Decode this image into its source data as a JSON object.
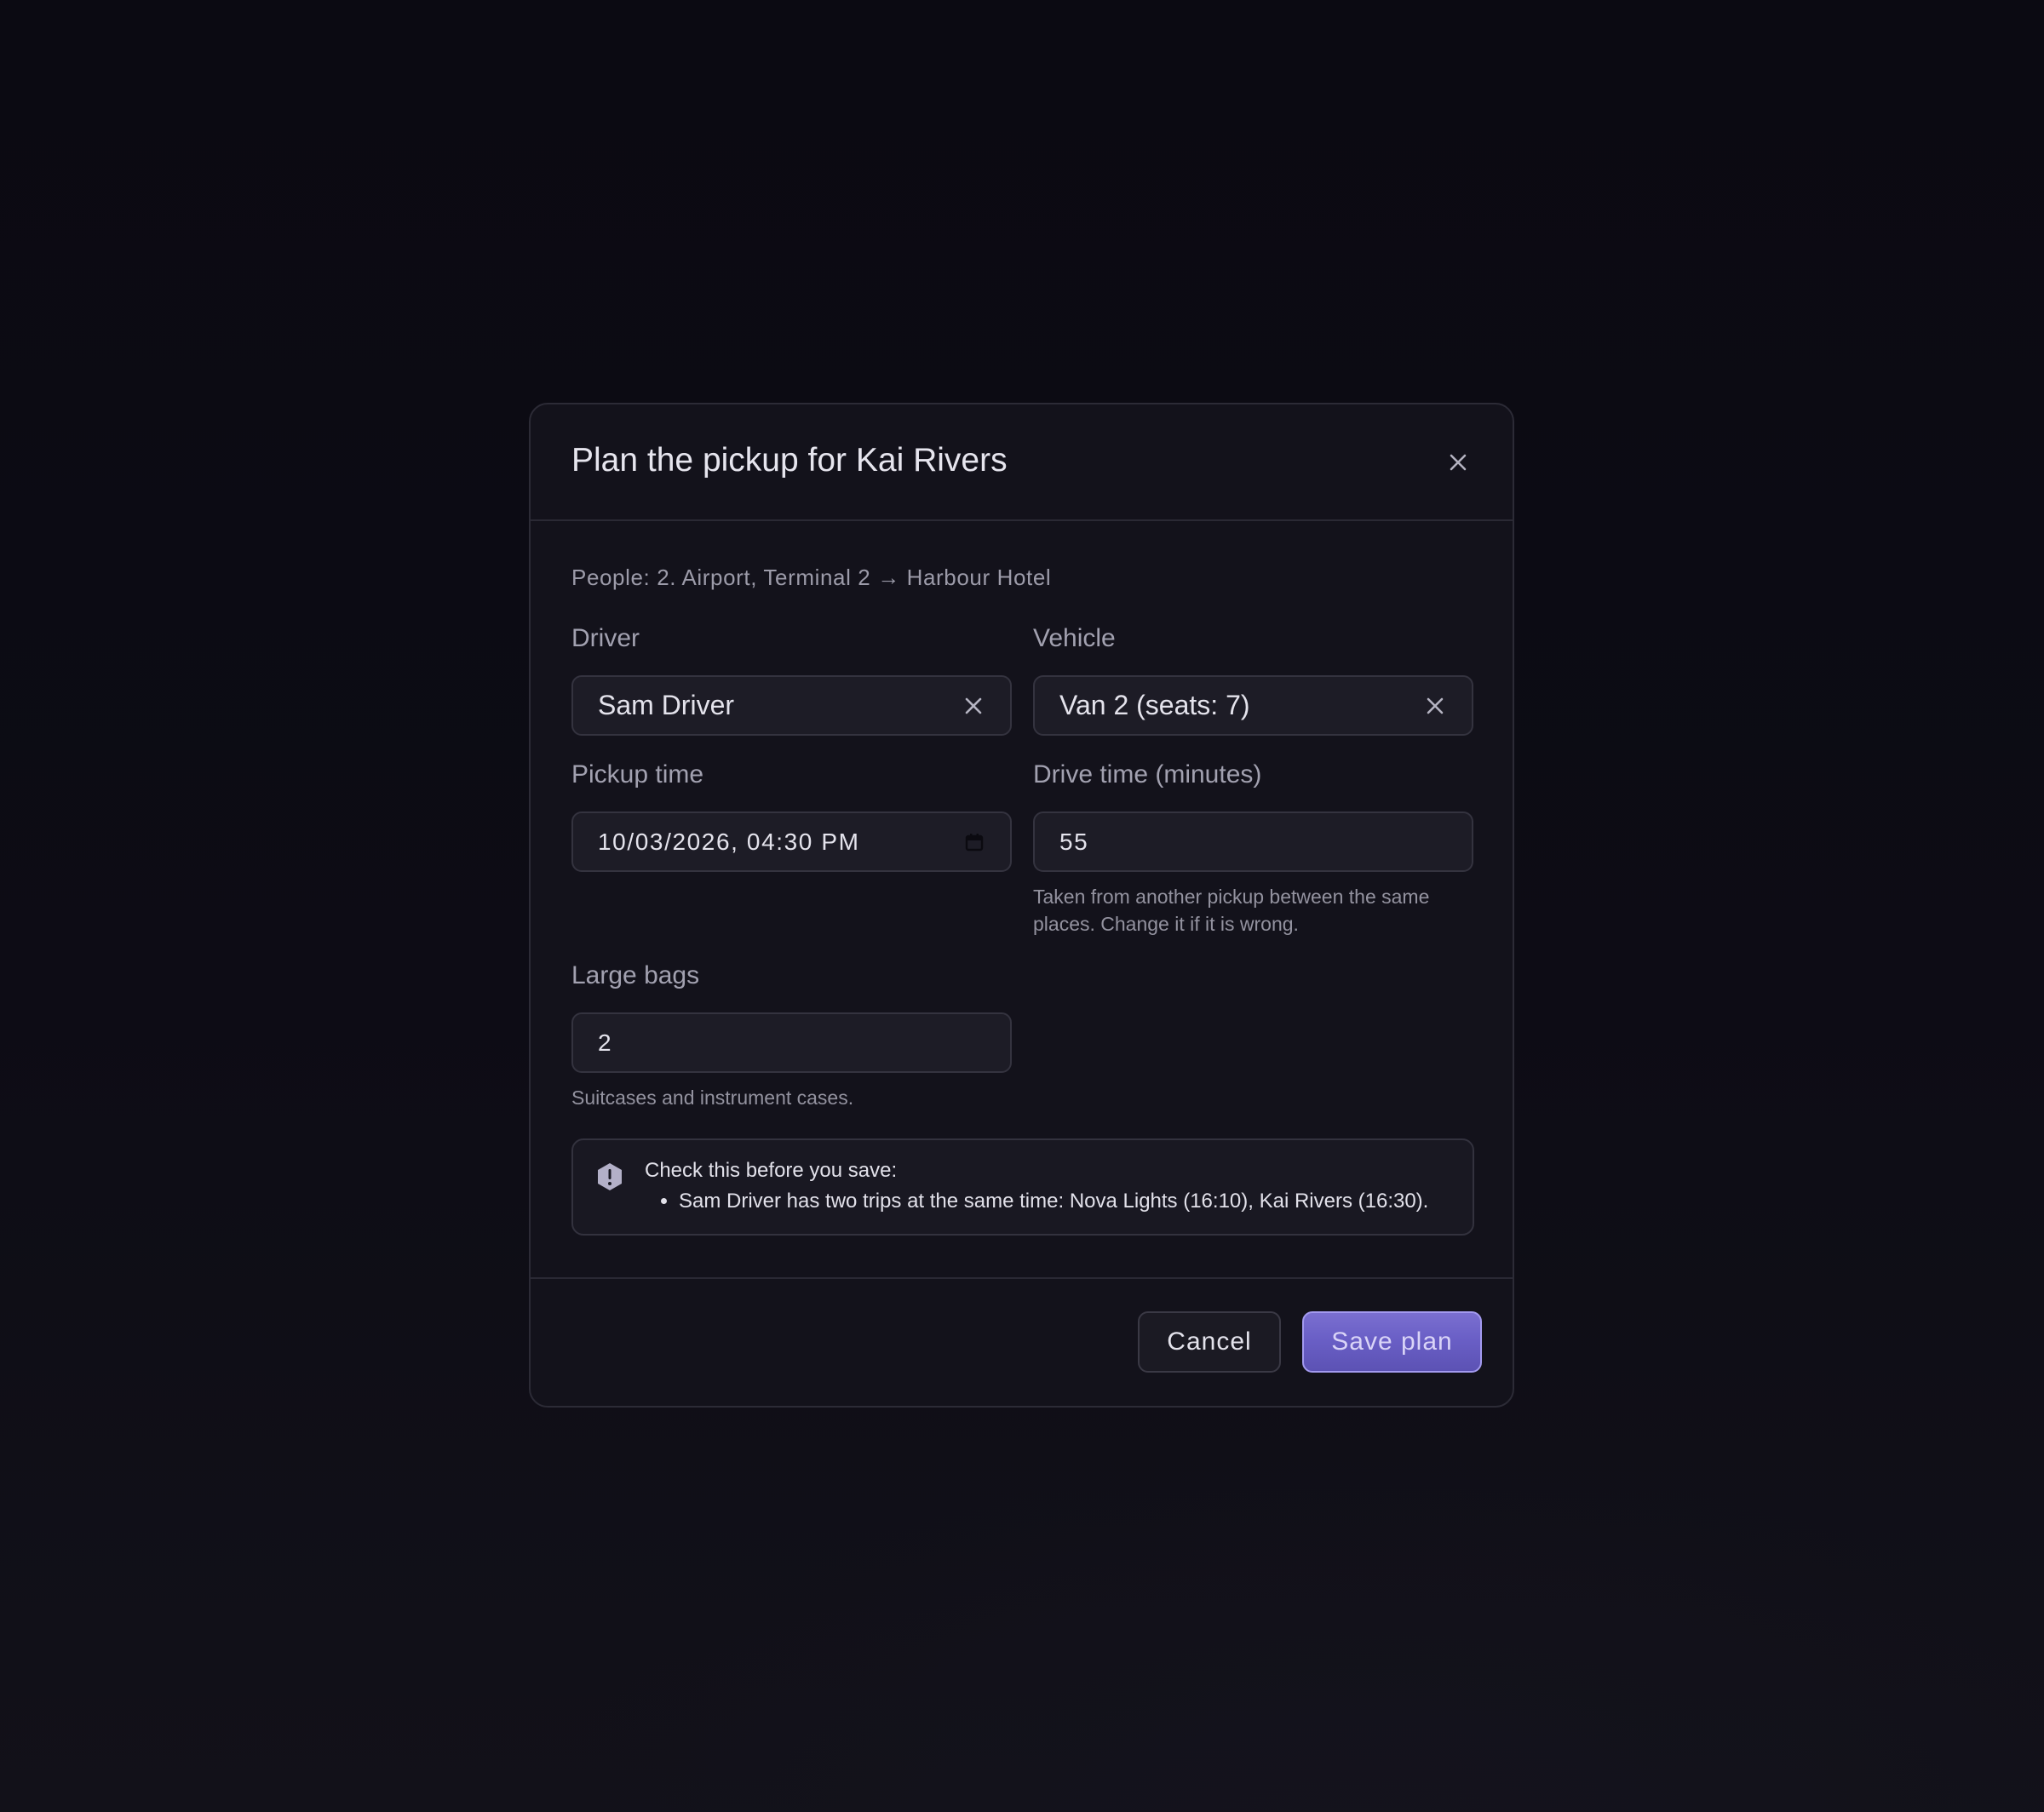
{
  "dialog": {
    "title": "Plan the pickup for Kai Rivers",
    "close_icon": "close-icon"
  },
  "summary": "People: 2. Airport, Terminal 2 → Harbour Hotel",
  "driver": {
    "label": "Driver",
    "value": "Sam Driver",
    "clear_icon": "close-icon"
  },
  "vehicle": {
    "label": "Vehicle",
    "value": "Van 2 (seats: 7)",
    "clear_icon": "close-icon"
  },
  "pickup_time": {
    "label": "Pickup time",
    "value": "10/03/2026, 04:30 PM",
    "icon": "calendar-icon"
  },
  "drive_time": {
    "label": "Drive time (minutes)",
    "value": "55",
    "help": "Taken from another pickup between the same places. Change it if it is wrong."
  },
  "large_bags": {
    "label": "Large bags",
    "value": "2",
    "help": "Suitcases and instrument cases."
  },
  "warning": {
    "icon": "warning-hexagon-icon",
    "title": "Check this before you save:",
    "items": [
      "Sam Driver has two trips at the same time: Nova Lights (16:10), Kai Rivers (16:30)."
    ]
  },
  "footer": {
    "cancel_label": "Cancel",
    "save_label": "Save plan"
  },
  "colors": {
    "background": "#0c0b14",
    "dialog": "#13121b",
    "field": "#1d1c26",
    "accent": "#6a5fc6",
    "accent_border": "#a39aef"
  }
}
